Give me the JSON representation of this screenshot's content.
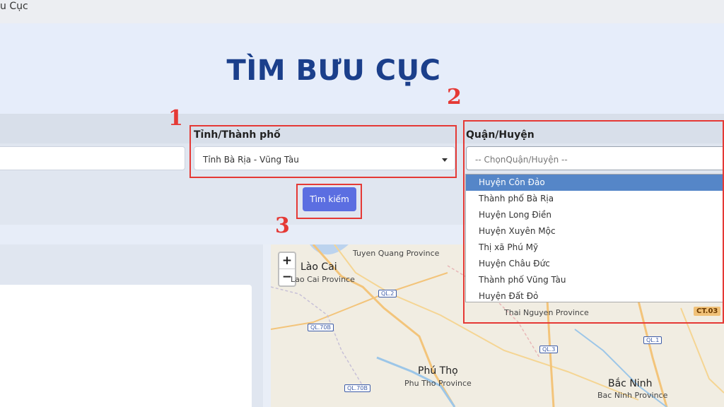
{
  "topbar": {
    "title_fragment": "u Cục"
  },
  "hero": {
    "title": "TÌM BƯU CỤC"
  },
  "form": {
    "province": {
      "label": "Tỉnh/Thành phố",
      "value": "Tỉnh Bà Rịa - Vũng Tàu"
    },
    "district": {
      "label": "Quận/Huyện",
      "placeholder": "-- ChọnQuận/Huyện --"
    },
    "search_button": "Tìm kiếm"
  },
  "annotations": [
    "1",
    "2",
    "3"
  ],
  "district_options": [
    {
      "label": "Huyện Côn Đảo",
      "selected": true
    },
    {
      "label": "Thành phố Bà Rịa",
      "selected": false
    },
    {
      "label": "Huyện Long Điền",
      "selected": false
    },
    {
      "label": "Huyện Xuyên Mộc",
      "selected": false
    },
    {
      "label": "Thị xã Phú Mỹ",
      "selected": false
    },
    {
      "label": "Huyện Châu Đức",
      "selected": false
    },
    {
      "label": "Thành phố Vũng Tàu",
      "selected": false
    },
    {
      "label": "Huyện Đất Đỏ",
      "selected": false
    }
  ],
  "map": {
    "zoom_in": "+",
    "zoom_out": "−",
    "labels": {
      "tuyen_quang": "Tuyen Quang Province",
      "lao_cai_city": "Lào Cai",
      "lao_cai_province": "Lao Cai Province",
      "thai_nguyen": "Thai Nguyen Province",
      "phu_tho_city": "Phú Thọ",
      "phu_tho_province": "Phu Tho Province",
      "bac_ninh_city": "Bắc Ninh",
      "bac_ninh_province": "Bac Ninh Province"
    },
    "shields": {
      "ql2": "QL.2",
      "ql70b": "QL.70B",
      "ql3": "QL.3",
      "ql1": "QL.1",
      "ql70b_2": "QL.70B"
    },
    "ct03": "CT.03"
  },
  "colors": {
    "accent": "#5b6ee1",
    "title": "#1b3f8b",
    "annotation": "#e53935",
    "selected": "#5586c8"
  }
}
